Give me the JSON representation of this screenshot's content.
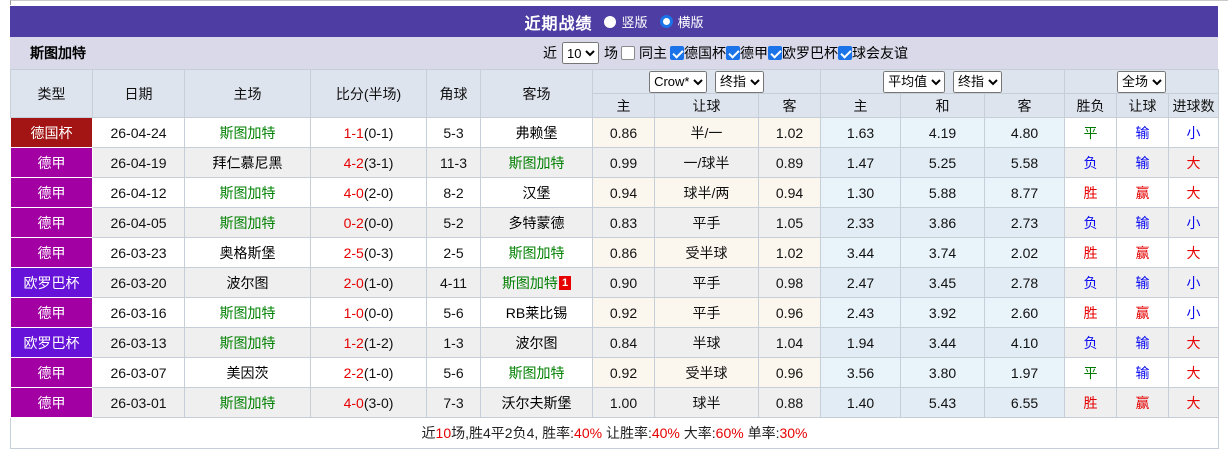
{
  "title_bar": {
    "title": "近期战绩",
    "radio_vertical_label": "竖版",
    "radio_horizontal_label": "横版",
    "selected_layout": "横版"
  },
  "filter_bar": {
    "team": "斯图加特",
    "recent_prefix": "近",
    "recent_count": "10",
    "recent_suffix": "场",
    "same_home_label": "同主",
    "same_home_checked": false,
    "league_filters": [
      {
        "label": "德国杯",
        "checked": true
      },
      {
        "label": "德甲",
        "checked": true
      },
      {
        "label": "欧罗巴杯",
        "checked": true
      },
      {
        "label": "球会友谊",
        "checked": true
      }
    ]
  },
  "table": {
    "static_headers": [
      "类型",
      "日期",
      "主场",
      "比分(半场)",
      "角球",
      "客场"
    ],
    "odds_group": {
      "select1": "Crow*",
      "select2": "终指",
      "cols": [
        "主",
        "让球",
        "客"
      ]
    },
    "avg_group": {
      "select1": "平均值",
      "select2": "终指",
      "cols": [
        "主",
        "和",
        "客"
      ]
    },
    "result_group": {
      "select": "全场",
      "cols": [
        "胜负",
        "让球",
        "进球数"
      ]
    },
    "rows": [
      {
        "type": "德国杯",
        "date": "26-04-24",
        "home": "斯图加特",
        "home_green": true,
        "score": "1-1",
        "half": "(0-1)",
        "corner": "5-3",
        "away": "弗赖堡",
        "away_green": false,
        "away_red_card": "",
        "odds": [
          "0.86",
          "半/一",
          "1.02"
        ],
        "avg": [
          "1.63",
          "4.19",
          "4.80"
        ],
        "results": [
          [
            "平",
            "green"
          ],
          [
            "输",
            "blue"
          ],
          [
            "小",
            "blue"
          ]
        ]
      },
      {
        "type": "德甲",
        "date": "26-04-19",
        "home": "拜仁慕尼黑",
        "home_green": false,
        "score": "4-2",
        "half": "(3-1)",
        "corner": "11-3",
        "away": "斯图加特",
        "away_green": true,
        "away_red_card": "",
        "odds": [
          "0.99",
          "一/球半",
          "0.89"
        ],
        "avg": [
          "1.47",
          "5.25",
          "5.58"
        ],
        "results": [
          [
            "负",
            "blue"
          ],
          [
            "输",
            "blue"
          ],
          [
            "大",
            "red"
          ]
        ]
      },
      {
        "type": "德甲",
        "date": "26-04-12",
        "home": "斯图加特",
        "home_green": true,
        "score": "4-0",
        "half": "(2-0)",
        "corner": "8-2",
        "away": "汉堡",
        "away_green": false,
        "away_red_card": "",
        "odds": [
          "0.94",
          "球半/两",
          "0.94"
        ],
        "avg": [
          "1.30",
          "5.88",
          "8.77"
        ],
        "results": [
          [
            "胜",
            "red"
          ],
          [
            "赢",
            "red"
          ],
          [
            "大",
            "red"
          ]
        ]
      },
      {
        "type": "德甲",
        "date": "26-04-05",
        "home": "斯图加特",
        "home_green": true,
        "score": "0-2",
        "half": "(0-0)",
        "corner": "5-2",
        "away": "多特蒙德",
        "away_green": false,
        "away_red_card": "",
        "odds": [
          "0.83",
          "平手",
          "1.05"
        ],
        "avg": [
          "2.33",
          "3.86",
          "2.73"
        ],
        "results": [
          [
            "负",
            "blue"
          ],
          [
            "输",
            "blue"
          ],
          [
            "小",
            "blue"
          ]
        ]
      },
      {
        "type": "德甲",
        "date": "26-03-23",
        "home": "奥格斯堡",
        "home_green": false,
        "score": "2-5",
        "half": "(0-3)",
        "corner": "2-5",
        "away": "斯图加特",
        "away_green": true,
        "away_red_card": "",
        "odds": [
          "0.86",
          "受半球",
          "1.02"
        ],
        "avg": [
          "3.44",
          "3.74",
          "2.02"
        ],
        "results": [
          [
            "胜",
            "red"
          ],
          [
            "赢",
            "red"
          ],
          [
            "大",
            "red"
          ]
        ]
      },
      {
        "type": "欧罗巴杯",
        "date": "26-03-20",
        "home": "波尔图",
        "home_green": false,
        "score": "2-0",
        "half": "(1-0)",
        "corner": "4-11",
        "away": "斯图加特",
        "away_green": true,
        "away_red_card": "1",
        "odds": [
          "0.90",
          "平手",
          "0.98"
        ],
        "avg": [
          "2.47",
          "3.45",
          "2.78"
        ],
        "results": [
          [
            "负",
            "blue"
          ],
          [
            "输",
            "blue"
          ],
          [
            "小",
            "blue"
          ]
        ]
      },
      {
        "type": "德甲",
        "date": "26-03-16",
        "home": "斯图加特",
        "home_green": true,
        "score": "1-0",
        "half": "(0-0)",
        "corner": "5-6",
        "away": "RB莱比锡",
        "away_green": false,
        "away_red_card": "",
        "odds": [
          "0.92",
          "平手",
          "0.96"
        ],
        "avg": [
          "2.43",
          "3.92",
          "2.60"
        ],
        "results": [
          [
            "胜",
            "red"
          ],
          [
            "赢",
            "red"
          ],
          [
            "小",
            "blue"
          ]
        ]
      },
      {
        "type": "欧罗巴杯",
        "date": "26-03-13",
        "home": "斯图加特",
        "home_green": true,
        "score": "1-2",
        "half": "(1-2)",
        "corner": "1-3",
        "away": "波尔图",
        "away_green": false,
        "away_red_card": "",
        "odds": [
          "0.84",
          "半球",
          "1.04"
        ],
        "avg": [
          "1.94",
          "3.44",
          "4.10"
        ],
        "results": [
          [
            "负",
            "blue"
          ],
          [
            "输",
            "blue"
          ],
          [
            "大",
            "red"
          ]
        ]
      },
      {
        "type": "德甲",
        "date": "26-03-07",
        "home": "美因茨",
        "home_green": false,
        "score": "2-2",
        "half": "(1-0)",
        "corner": "5-6",
        "away": "斯图加特",
        "away_green": true,
        "away_red_card": "",
        "odds": [
          "0.92",
          "受半球",
          "0.96"
        ],
        "avg": [
          "3.56",
          "3.80",
          "1.97"
        ],
        "results": [
          [
            "平",
            "green"
          ],
          [
            "输",
            "blue"
          ],
          [
            "大",
            "red"
          ]
        ]
      },
      {
        "type": "德甲",
        "date": "26-03-01",
        "home": "斯图加特",
        "home_green": true,
        "score": "4-0",
        "half": "(3-0)",
        "corner": "7-3",
        "away": "沃尔夫斯堡",
        "away_green": false,
        "away_red_card": "",
        "odds": [
          "1.00",
          "球半",
          "0.88"
        ],
        "avg": [
          "1.40",
          "5.43",
          "6.55"
        ],
        "results": [
          [
            "胜",
            "red"
          ],
          [
            "赢",
            "red"
          ],
          [
            "大",
            "red"
          ]
        ]
      }
    ],
    "footer_segments": [
      [
        "近",
        "k"
      ],
      [
        "10",
        "r"
      ],
      [
        "场,胜4平2负4, 胜率:",
        "k"
      ],
      [
        "40%",
        "r"
      ],
      [
        " 让胜率:",
        "k"
      ],
      [
        "40%",
        "r"
      ],
      [
        " 大率:",
        "k"
      ],
      [
        "60%",
        "r"
      ],
      [
        " 单率:",
        "k"
      ],
      [
        "30%",
        "r"
      ]
    ]
  },
  "colors": {
    "type_bg": {
      "德国杯": "#a31414",
      "德甲": "#a300a3",
      "欧罗巴杯": "#6612d8"
    },
    "result": {
      "red": "#e60000",
      "blue": "#0b0bf0",
      "green": "#007a00"
    },
    "accent_blue": "#1a73e8",
    "title_bar_bg": "#4e3da2",
    "filter_bar_bg": "#d9d9e9",
    "header_bg": "#dee4ee"
  }
}
